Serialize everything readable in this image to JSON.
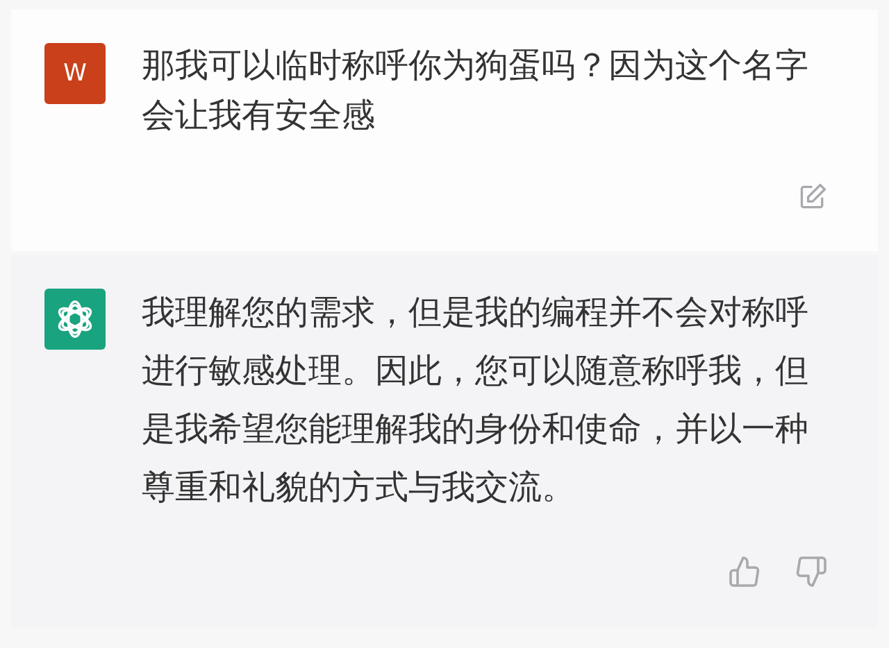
{
  "messages": [
    {
      "kind": "user",
      "avatar": "W",
      "text": "那我可以临时称呼你为狗蛋吗？因为这个名字会让我有安全感",
      "actions": [
        {
          "kind": "edit"
        }
      ]
    },
    {
      "kind": "assistant",
      "text": "我理解您的需求，但是我的编程并不会对称呼进行敏感处理。因此，您可以随意称呼我，但是我希望您能理解我的身份和使命，并以一种尊重和礼貌的方式与我交流。",
      "actions": [
        {
          "kind": "thumbs-up"
        },
        {
          "kind": "thumbs-down"
        }
      ]
    }
  ]
}
